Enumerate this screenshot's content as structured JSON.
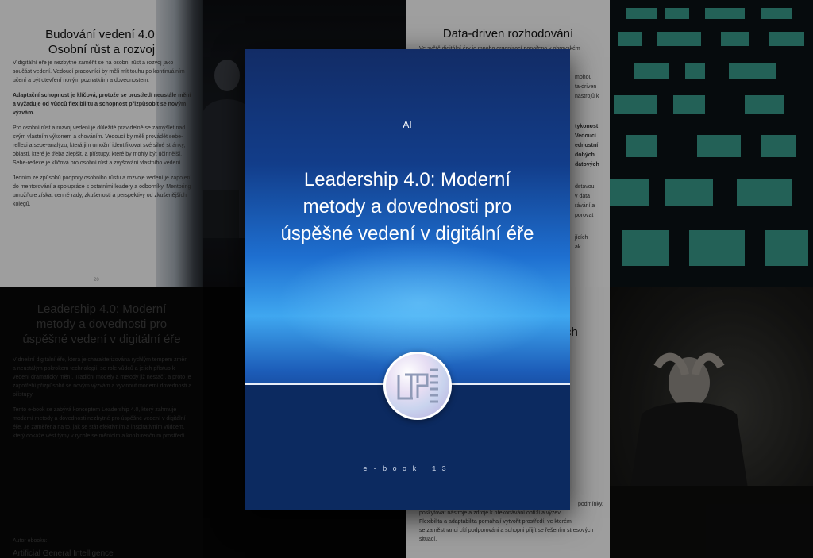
{
  "cover": {
    "tag": "AI",
    "title_lines": [
      "Leadership 4.0: Moderní",
      "metody a dovednosti pro",
      "úspěšné vedení v digitální éře"
    ],
    "ebook_label": "e-book 13"
  },
  "page_top_left": {
    "title_lines": [
      "Budování vedení 4.0:",
      "Osobní růst a rozvoj"
    ],
    "paragraphs": [
      "V digitální éře je nezbytné zaměřit se na osobní růst a rozvoj jako součást vedení. Vedoucí pracovníci by měli mít touhu po kontinuálním učení a být otevření novým poznatkům a dovednostem.",
      "Adaptační schopnost je klíčová, protože se prostředí neustále mění a vyžaduje od vůdců flexibilitu a schopnost přizpůsobit se novým výzvám.",
      "Pro osobní růst a rozvoj vedení je důležité pravidelně se zamýšlet nad svým vlastním výkonem a chováním. Vedoucí by měli provádět sebe-reflexi a sebe-analýzu, která jim umožní identifikovat své silné stránky, oblasti, které je třeba zlepšit, a přístupy, které by mohly být účinnější. Sebe-reflexe je klíčová pro osobní růst a zvyšování vlastního vedení.",
      "Jedním ze způsobů podpory osobního růstu a rozvoje vedení je zapojení do mentorování a spolupráce s ostatními leadery a odborníky. Mentoring umožňuje získat cenné rady, zkušenosti a perspektivy od zkušenějších kolegů."
    ],
    "page_number": "20"
  },
  "page_top_right": {
    "title": "Data-driven rozhodování",
    "lines": [
      "Ve světě digitální éry je mnoho organizací ponořeno v obrovském",
      "mohou",
      "ta-driven",
      "nástrojů k",
      "tykonost",
      "Vedoucí",
      "ednostní",
      "dobých",
      "datových",
      "dstavou",
      "v data",
      "rávání a",
      "porovat",
      "jících",
      "ak."
    ]
  },
  "page_bottom_left": {
    "title_lines": [
      "Leadership 4.0: Moderní",
      "metody a dovednosti pro",
      "úspěšné vedení v digitální éře"
    ],
    "paragraphs": [
      "V dnešní digitální éře, která je charakterizována rychlým tempem změn a neustálým pokrokem technologií, se role vůdců a jejich přístup k vedení dramaticky mění. Tradiční modely a metody již nestačí, a proto je zapotřebí přizpůsobit se novým výzvám a vyvinout moderní dovednosti a přístupy.",
      "Tento e-book se zabývá konceptem Leadership 4.0, který zahrnuje moderní metody a dovednosti nezbytné pro úspěšné vedení v digitální éře. Je zaměřena na to, jak se stát efektivním a inspirativním vůdcem, který dokáže vést týmy v rychle se měnícím a konkurenčním prostředí."
    ],
    "author_label": "Autor ebooku:",
    "author": "Artificial General Intelligence"
  },
  "page_bottom_right": {
    "heading_fragment": "ch",
    "lines": [
      "podmínky,",
      "poskytovat nástroje a zdroje k překonávání obtíží a výzev.",
      "Flexibilita a adaptabilita pomáhají vytvořit prostředí, ve kterém",
      "se zaměstnanci cítí podporováni a schopni přijít se řešením stresových",
      "situací."
    ]
  }
}
